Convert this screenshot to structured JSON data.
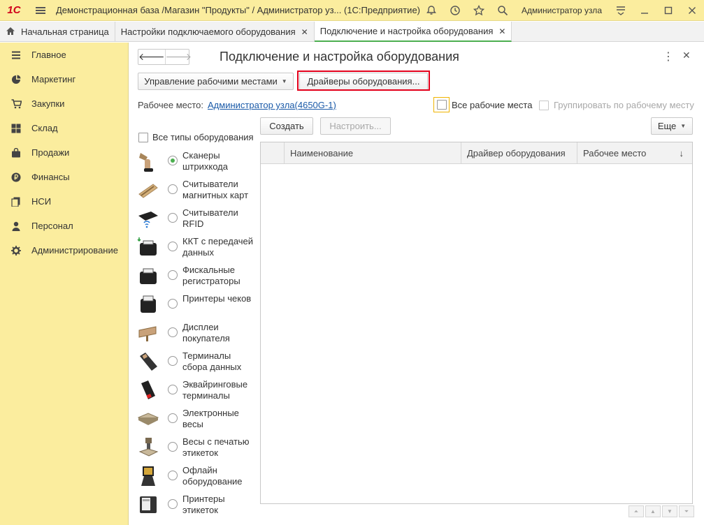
{
  "titlebar": {
    "logo": "1С",
    "title": "Демонстрационная база /Магазин \"Продукты\" / Администратор уз... (1С:Предприятие)",
    "user": "Администратор узла"
  },
  "tabs": [
    {
      "label": "Начальная страница"
    },
    {
      "label": "Настройки подключаемого оборудования"
    },
    {
      "label": "Подключение и настройка оборудования"
    }
  ],
  "sidebar": {
    "items": [
      {
        "label": "Главное",
        "icon": "menu-icon"
      },
      {
        "label": "Маркетинг",
        "icon": "pie-chart-icon"
      },
      {
        "label": "Закупки",
        "icon": "cart-icon"
      },
      {
        "label": "Склад",
        "icon": "grid-icon"
      },
      {
        "label": "Продажи",
        "icon": "bag-icon"
      },
      {
        "label": "Финансы",
        "icon": "ruble-icon"
      },
      {
        "label": "НСИ",
        "icon": "copy-icon"
      },
      {
        "label": "Персонал",
        "icon": "person-icon"
      },
      {
        "label": "Администрирование",
        "icon": "gear-icon"
      }
    ]
  },
  "form": {
    "title": "Подключение и настройка оборудования",
    "workplaces_button": "Управление рабочими местами",
    "drivers_button": "Драйверы оборудования...",
    "workplace_label": "Рабочее место:",
    "workplace_value": "Администратор узла(4650G-1)",
    "all_workplaces": "Все рабочие места",
    "group_by_workplace": "Группировать по рабочему месту",
    "all_types": "Все типы оборудования",
    "create_button": "Создать",
    "configure_button": "Настроить...",
    "more_button": "Еще"
  },
  "equipment_types": [
    {
      "label": "Сканеры штрихкода",
      "selected": true
    },
    {
      "label": "Считыватели магнитных карт",
      "selected": false
    },
    {
      "label": "Считыватели RFID",
      "selected": false
    },
    {
      "label": "ККТ с передачей данных",
      "selected": false
    },
    {
      "label": "Фискальные регистраторы",
      "selected": false
    },
    {
      "label": "Принтеры чеков",
      "selected": false
    },
    {
      "label": "Дисплеи покупателя",
      "selected": false
    },
    {
      "label": "Терминалы сбора данных",
      "selected": false
    },
    {
      "label": "Эквайринговые терминалы",
      "selected": false
    },
    {
      "label": "Электронные весы",
      "selected": false
    },
    {
      "label": "Весы с печатью этикеток",
      "selected": false
    },
    {
      "label": "Офлайн оборудование",
      "selected": false
    },
    {
      "label": "Принтеры этикеток",
      "selected": false
    }
  ],
  "table": {
    "columns": [
      "Наименование",
      "Драйвер оборудования",
      "Рабочее место"
    ],
    "sort_indicator": "↓"
  },
  "colors": {
    "accent_yellow": "#fbed9e",
    "highlight_red": "#e3001b",
    "link_blue": "#1a5aa8",
    "radio_green": "#4caf50"
  }
}
